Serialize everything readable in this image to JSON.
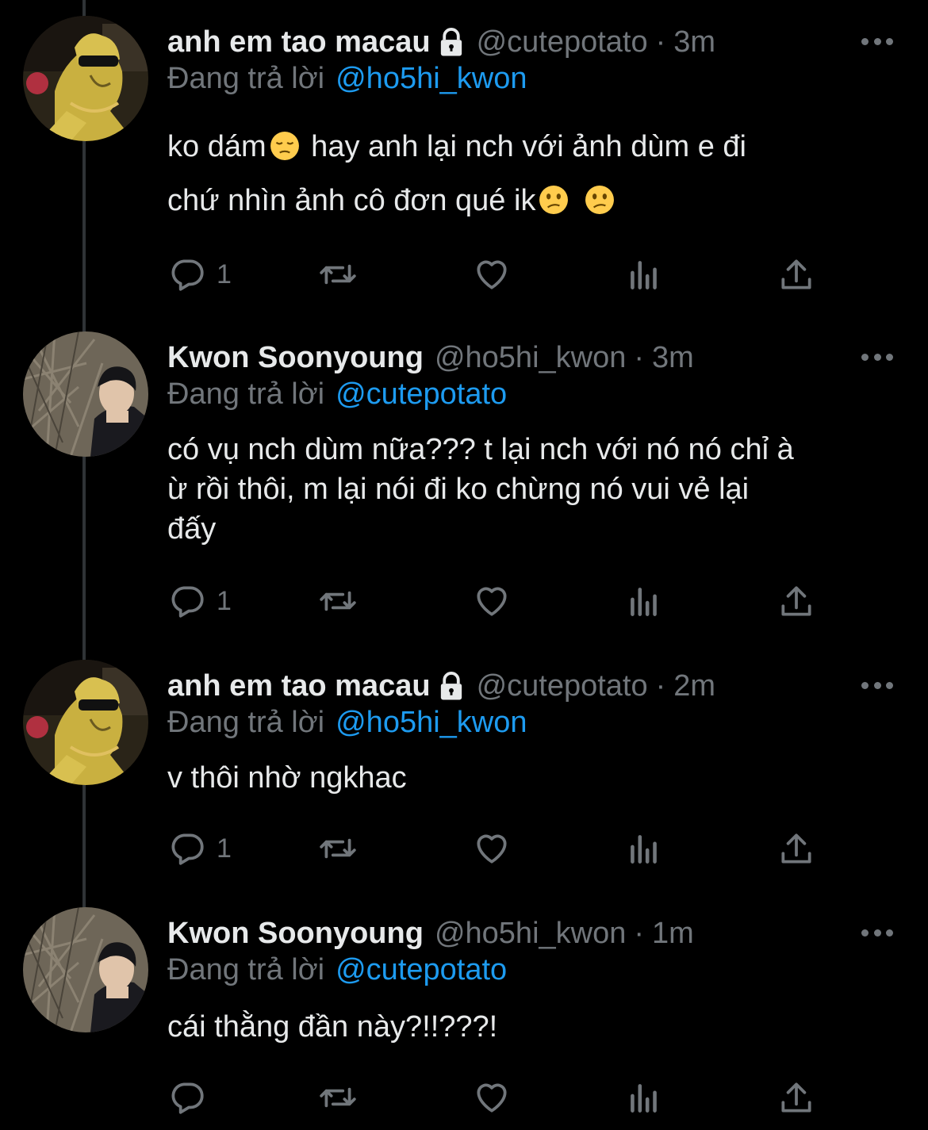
{
  "tweets": [
    {
      "name": "anh em tao macau",
      "handle": "@cutepotato",
      "dot": "·",
      "time": "3m",
      "replying_label": "Đang trả lời",
      "replying_to": "@ho5hi_kwon",
      "text_lines": [
        "ko dám",
        "  hay anh lại nch với ảnh dùm e đi",
        "chứ nhìn ảnh cô đơn qué ik"
      ],
      "reply_count": "1",
      "avatar": "dog-sunglasses-avatar",
      "protected": true
    },
    {
      "name": "Kwon Soonyoung",
      "handle": "@ho5hi_kwon",
      "dot": "·",
      "time": "3m",
      "replying_label": "Đang trả lời",
      "replying_to": "@cutepotato",
      "text_lines": [
        "có vụ nch dùm nữa??? t lại nch với nó nó chỉ à",
        "ừ rồi thôi, m lại nói đi ko chừng nó vui vẻ lại",
        "đấy"
      ],
      "reply_count": "1",
      "avatar": "person-photo-avatar",
      "protected": false
    },
    {
      "name": "anh em tao macau",
      "handle": "@cutepotato",
      "dot": "·",
      "time": "2m",
      "replying_label": "Đang trả lời",
      "replying_to": "@ho5hi_kwon",
      "text_lines": [
        "v thôi nhờ ngkhac"
      ],
      "reply_count": "1",
      "avatar": "dog-sunglasses-avatar",
      "protected": true
    },
    {
      "name": "Kwon Soonyoung",
      "handle": "@ho5hi_kwon",
      "dot": "·",
      "time": "1m",
      "replying_label": "Đang trả lời",
      "replying_to": "@cutepotato",
      "text_lines": [
        "cái thằng đần này?!!???!"
      ],
      "reply_count": "",
      "avatar": "person-photo-avatar",
      "protected": false
    }
  ],
  "icons": {
    "reply": "reply-icon",
    "retweet": "retweet-icon",
    "like": "heart-icon",
    "views": "views-icon",
    "share": "share-icon",
    "more": "more-icon",
    "lock": "lock-icon",
    "emoji_pensive": "pensive-face-emoji",
    "emoji_confused": "confused-face-emoji"
  },
  "colors": {
    "background": "#000000",
    "text": "#e7e9ea",
    "secondary": "#71767b",
    "accent": "#1d9bf0"
  }
}
